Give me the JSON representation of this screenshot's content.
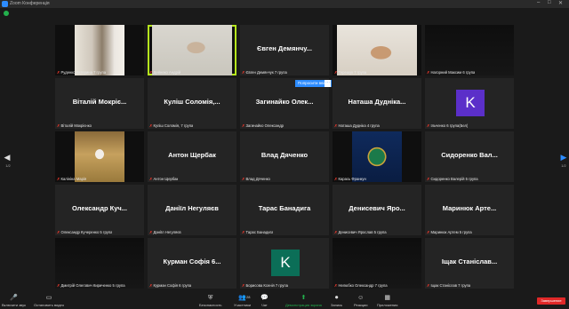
{
  "window": {
    "title": "Zoom Конференція",
    "min": "–",
    "max": "□",
    "close": "✕"
  },
  "colors": {
    "accent": "#2d8cff",
    "active_speaker": "#b5e61d",
    "muted_mic": "#e2372b",
    "avatar_purple": "#5b2fc9",
    "avatar_teal": "#0b6e57",
    "end": "#e02828"
  },
  "tiles": [
    {
      "caption": "Руденко Катерина 7 група",
      "video": "lab"
    },
    {
      "caption": "Дейнеко Андрій",
      "video": "man",
      "speaking": true
    },
    {
      "name": "Євген Демянчу...",
      "caption": "Євген Демянчук 7 група"
    },
    {
      "caption": "Терешук 7 група",
      "video": "object"
    },
    {
      "caption": "Нагорний Максим 6 група",
      "video": "dark"
    },
    {
      "name": "Віталій Мокріє...",
      "caption": "Віталій Мокрієнко"
    },
    {
      "name": "Куліш Соломія,...",
      "caption": "Куліш Соломія, 7 група"
    },
    {
      "name": "Загинайко Олек...",
      "caption": "Загинайко Олександр"
    },
    {
      "name": "Наташа Дуднікa...",
      "caption": "Наташа Дудніка 4 група"
    },
    {
      "avatar": "K",
      "avatar_color": "#5b2fc9",
      "caption": "Ільченко 6 група(Бел)"
    },
    {
      "caption": "Калініна Марія",
      "video": "girl"
    },
    {
      "name": "Антон Щербак",
      "caption": "Антон Щербак"
    },
    {
      "name": "Влад Дяченко",
      "caption": "Влад Дяченко"
    },
    {
      "caption": "Карась Франкун",
      "video": "emblem"
    },
    {
      "name": "Сидоренко Вал...",
      "caption": "Сидоренко Валерій 5 група"
    },
    {
      "name": "Олександр Куч...",
      "caption": "Олександр Кучеренко 5 група"
    },
    {
      "name": "Даніїл Негуляєв",
      "caption": "Даніїл Негуляєв"
    },
    {
      "name": "Тарас Банадига",
      "caption": "Тарас Банадига"
    },
    {
      "name": "Денисевич Яро...",
      "caption": "Денисевич Ярослав 5 група"
    },
    {
      "name": "Маринюк Арте...",
      "caption": "Маринюк Артем 5 група"
    },
    {
      "caption": "Дмитрій Олегович Кириченко 5 група",
      "video": "dark"
    },
    {
      "name": "Курман Софія 6...",
      "caption": "Курман Софія 6 група"
    },
    {
      "avatar": "K",
      "avatar_color": "#0b6e57",
      "caption": "Борисова Ксенія 7 група"
    },
    {
      "caption": "Нелюбко Олександр 7 група",
      "video": "dark"
    },
    {
      "name": "Іщак Станіслав...",
      "caption": "Іщак Станіслав 7 група"
    }
  ],
  "popup": {
    "label": "Попросити ввімк",
    "more": "···"
  },
  "pager": {
    "left_arrow": "◀",
    "right_arrow": "▶",
    "left_page": "1/2",
    "right_page": "1/2"
  },
  "toolbar": [
    {
      "icon": "mic-off-icon",
      "glyph": "🎤",
      "label": "Включити звук"
    },
    {
      "icon": "video-off-icon",
      "glyph": "▭",
      "label": "Остановить видео"
    },
    {
      "icon": "shield-icon",
      "glyph": "⛨",
      "label": "Безопасность"
    },
    {
      "icon": "participants-icon",
      "glyph": "👥",
      "label": "Участники",
      "count": "28"
    },
    {
      "icon": "chat-icon",
      "glyph": "💬",
      "label": "Чат"
    },
    {
      "icon": "share-screen-icon",
      "glyph": "⬆",
      "label": "Демонстрация экрана"
    },
    {
      "icon": "record-icon",
      "glyph": "⏺",
      "label": "Запись"
    },
    {
      "icon": "reactions-icon",
      "glyph": "☺",
      "label": "Реакции"
    },
    {
      "icon": "apps-icon",
      "glyph": "▦",
      "label": "Приложения"
    }
  ],
  "end_button": "Завершение"
}
